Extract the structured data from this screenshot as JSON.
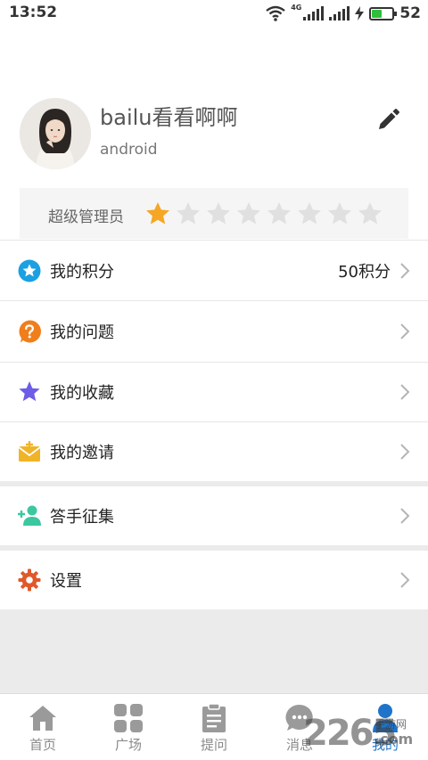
{
  "status_bar": {
    "time": "13:52",
    "network": "4G",
    "battery_level": "52",
    "battery_fraction": 0.52,
    "battery_color": "#2fbf3a"
  },
  "profile": {
    "username": "bailu看看啊啊",
    "subtitle": "android"
  },
  "rank": {
    "label": "超级管理员",
    "rating": 1,
    "max_rating": 8,
    "star_color_on": "#f5a623",
    "star_color_off": "#e0e0e0"
  },
  "menu": {
    "points": {
      "label": "我的积分",
      "value": "50积分",
      "icon": "star-circle-icon",
      "icon_color": "#1ba0e2"
    },
    "questions": {
      "label": "我的问题",
      "icon": "question-bubble-icon",
      "icon_color": "#f07f1b"
    },
    "favorites": {
      "label": "我的收藏",
      "icon": "star-icon",
      "icon_color": "#6c5ce7"
    },
    "invites": {
      "label": "我的邀请",
      "icon": "envelope-icon",
      "icon_color": "#f0b429"
    },
    "recruit": {
      "label": "答手征集",
      "icon": "add-user-icon",
      "icon_color": "#3cc7a0"
    },
    "settings": {
      "label": "设置",
      "icon": "gear-icon",
      "icon_color": "#e0592a"
    }
  },
  "tabs": [
    {
      "label": "首页",
      "icon": "home-icon"
    },
    {
      "label": "广场",
      "icon": "grid-icon"
    },
    {
      "label": "提问",
      "icon": "clipboard-icon"
    },
    {
      "label": "消息",
      "icon": "chat-icon"
    },
    {
      "label": "我的",
      "icon": "person-icon"
    }
  ],
  "active_tab_color": "#1f74c9",
  "watermark": {
    "number": "2265",
    "sub": "手游网",
    "domain": ".com"
  }
}
